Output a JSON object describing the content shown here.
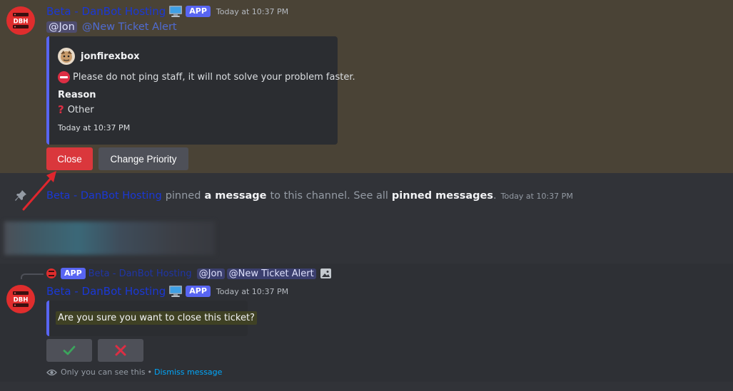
{
  "message1": {
    "author": "Beta - DanBot Hosting",
    "app_badge": "APP",
    "timestamp": "Today at 10:37 PM",
    "mention_user": "@Jon",
    "mention_role": "@New Ticket Alert",
    "embed": {
      "author_name": "jonfirexbox",
      "description": "Please do not ping staff, it will not solve your problem faster.",
      "field_name": "Reason",
      "field_value": "Other",
      "footer": "Today at 10:37 PM",
      "accent_color": "#5865f2"
    },
    "buttons": {
      "close_label": "Close",
      "change_priority_label": "Change Priority"
    },
    "avatar_text": "DBH"
  },
  "system_message": {
    "author": "Beta - DanBot Hosting",
    "text_pinned": "pinned",
    "text_a_message": "a message",
    "text_to_channel": "to this channel. See all",
    "text_pinned_messages": "pinned messages",
    "text_period": ".",
    "timestamp": "Today at 10:37 PM"
  },
  "message2": {
    "reply": {
      "app_badge": "APP",
      "author": "Beta - DanBot Hosting",
      "mention_user": "@Jon",
      "mention_role": "@New Ticket Alert"
    },
    "author": "Beta - DanBot Hosting",
    "app_badge": "APP",
    "timestamp": "Today at 10:37 PM",
    "embed_text": "Are you sure you want to close this ticket?",
    "confirm_icon": "checkmark-icon",
    "cancel_icon": "cross-icon",
    "ephemeral_text": "Only you can see this",
    "ephemeral_sep": "•",
    "dismiss_label": "Dismiss message",
    "avatar_text": "DBH"
  },
  "colors": {
    "highlight_bg": "#4a4336",
    "author_color": "#1a38d6",
    "danger": "#da373c",
    "secondary": "#4e5058",
    "blurple": "#5865f2",
    "annotation_arrow": "#e0262d"
  }
}
